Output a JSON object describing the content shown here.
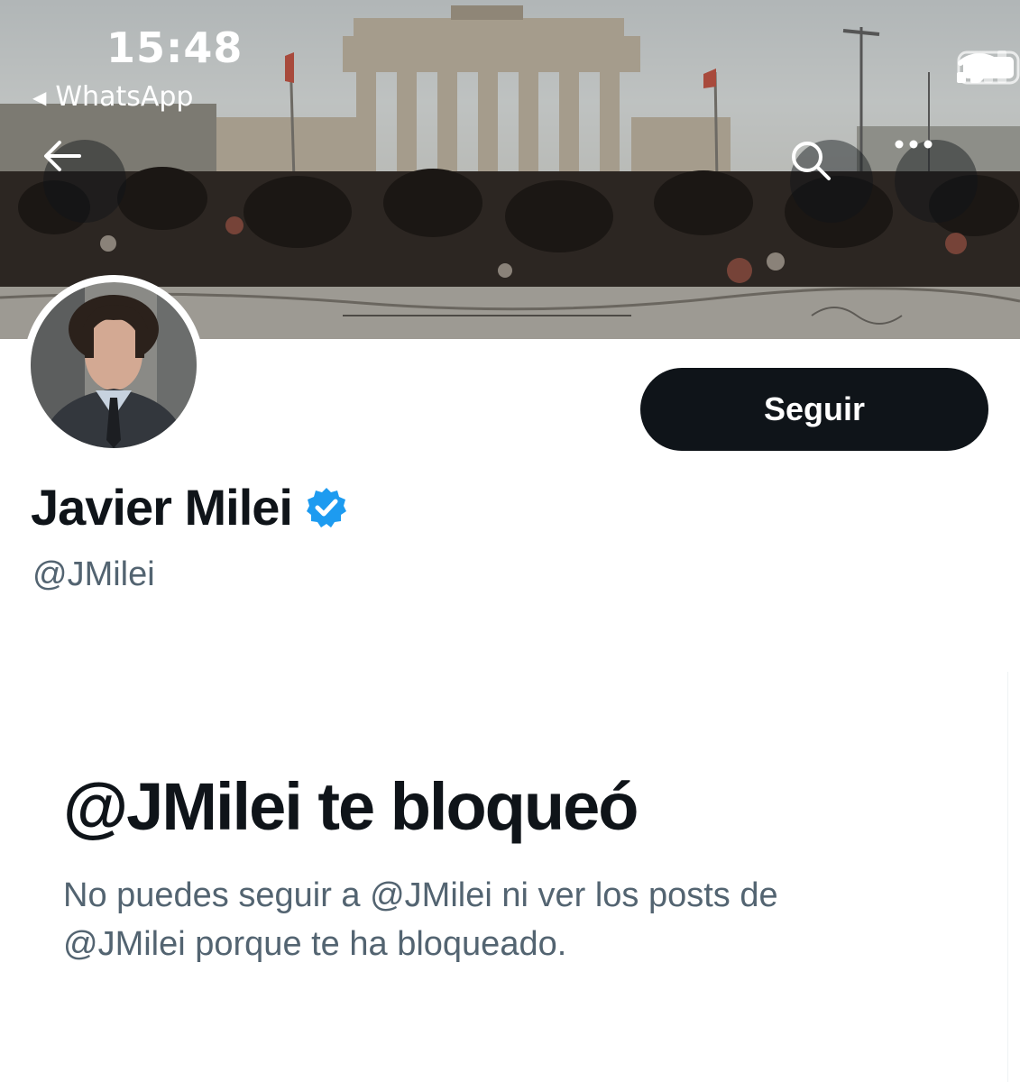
{
  "status_bar": {
    "time": "15:48",
    "back_app": "WhatsApp",
    "icons": [
      "signal-icon",
      "wifi-icon",
      "battery-icon"
    ]
  },
  "banner": {
    "icons": [
      "back-arrow-icon",
      "search-icon",
      "more-icon"
    ]
  },
  "profile": {
    "display_name": "Javier Milei",
    "handle": "@JMilei",
    "verified": true,
    "follow_label": "Seguir"
  },
  "blocked": {
    "title": "@JMilei te bloqueó",
    "message_line1": "No puedes seguir a @JMilei ni ver los posts de",
    "message_line2": "@JMilei porque te ha bloqueado."
  },
  "colors": {
    "text_primary": "#0f1419",
    "text_secondary": "#536471",
    "verified_blue": "#1d9bf0",
    "button_bg": "#0f1419"
  }
}
